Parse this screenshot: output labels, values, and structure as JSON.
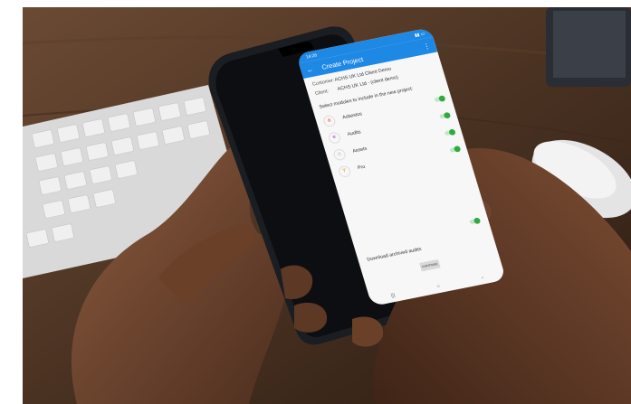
{
  "status_bar": {
    "time": "14:26",
    "icons": "signal-battery-icon"
  },
  "appbar": {
    "title": "Create Project",
    "back_icon": "back-arrow-icon",
    "menu_icon": "overflow-menu-icon"
  },
  "form": {
    "customer_label": "Customer:",
    "customer_value": "ACHS UK Ltd Client Demo",
    "client_label": "Client:",
    "client_value": "ACHS UK Ltd - (client demo)",
    "modules_heading": "Select modules to include in the new project:"
  },
  "modules": [
    {
      "label": "Asbestos",
      "icon": "asbestos-icon",
      "color": "#e53935",
      "glyph": "a",
      "enabled": true
    },
    {
      "label": "Audits",
      "icon": "audits-icon",
      "color": "#8e24aa",
      "glyph": "≡",
      "enabled": true
    },
    {
      "label": "Assets",
      "icon": "assets-icon",
      "color": "#43a047",
      "glyph": "⌂",
      "enabled": true
    },
    {
      "label": "Pro",
      "icon": "pro-icon",
      "color": "#fb8c00",
      "glyph": "Y",
      "enabled": true
    }
  ],
  "archived": {
    "label": "Download archived audits",
    "enabled": true
  },
  "continue_button": {
    "label": "CONTINUE",
    "icon": "chevron-right-icon"
  },
  "navbar": {
    "recent": "|||",
    "home": "○",
    "back": "‹"
  }
}
